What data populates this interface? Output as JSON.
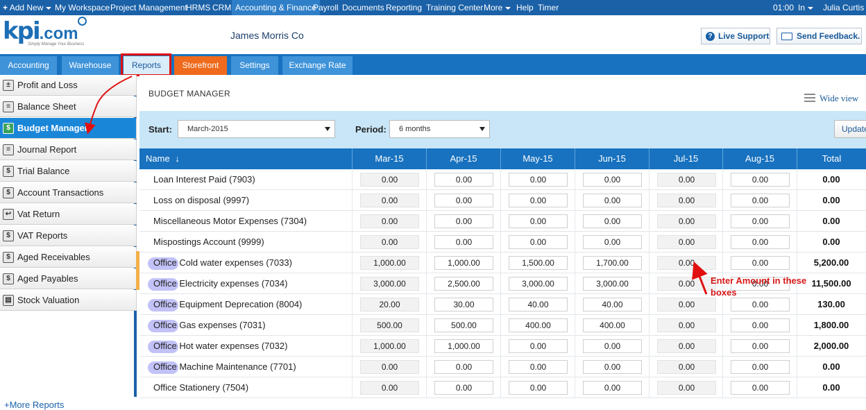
{
  "topnav": {
    "items": [
      {
        "label": "Add New",
        "active": false
      },
      {
        "label": "My Workspace",
        "active": false
      },
      {
        "label": "Project Management",
        "active": false
      },
      {
        "label": "HRMS",
        "active": false
      },
      {
        "label": "CRM",
        "active": false
      },
      {
        "label": "Accounting & Finance",
        "active": true
      },
      {
        "label": "Payroll",
        "active": false
      },
      {
        "label": "Documents",
        "active": false
      },
      {
        "label": "Reporting",
        "active": false
      },
      {
        "label": "Training Center",
        "active": false
      },
      {
        "label": "More",
        "active": false
      },
      {
        "label": "Help",
        "active": false
      },
      {
        "label": "Timer",
        "active": false
      }
    ],
    "clock": "01:00",
    "status": "In",
    "user": "Julia Curtis"
  },
  "header": {
    "logo_main": "kpi",
    "logo_suffix": ".com",
    "logo_tagline": "Simply Manage Your Business",
    "company": "James Morris Co",
    "live_support": "Live Support",
    "send_feedback": "Send Feedback."
  },
  "tabs": [
    {
      "label": "Accounting",
      "state": "normal"
    },
    {
      "label": "Warehouse",
      "state": "normal"
    },
    {
      "label": "Reports",
      "state": "active"
    },
    {
      "label": "Storefront",
      "state": "orange"
    },
    {
      "label": "Settings",
      "state": "normal"
    },
    {
      "label": "Exchange Rate",
      "state": "normal"
    }
  ],
  "sidebar": {
    "items": [
      {
        "label": "Profit and Loss",
        "icon": "profit-loss-icon",
        "active": false
      },
      {
        "label": "Balance Sheet",
        "icon": "balance-sheet-icon",
        "active": false
      },
      {
        "label": "Budget Manager",
        "icon": "budget-manager-icon",
        "active": true
      },
      {
        "label": "Journal Report",
        "icon": "journal-report-icon",
        "active": false
      },
      {
        "label": "Trial Balance",
        "icon": "trial-balance-icon",
        "active": false
      },
      {
        "label": "Account Transactions",
        "icon": "account-transactions-icon",
        "active": false
      },
      {
        "label": "Vat Return",
        "icon": "vat-return-icon",
        "active": false
      },
      {
        "label": "VAT Reports",
        "icon": "vat-reports-icon",
        "active": false
      },
      {
        "label": "Aged Receivables",
        "icon": "aged-receivables-icon",
        "active": false
      },
      {
        "label": "Aged Payables",
        "icon": "aged-payables-icon",
        "active": false
      },
      {
        "label": "Stock Valuation",
        "icon": "stock-valuation-icon",
        "active": false
      }
    ],
    "more": "+More Reports"
  },
  "main": {
    "title": "BUDGET MANAGER",
    "wide_view": "Wide view",
    "start_label": "Start:",
    "start_value": "March-2015",
    "period_label": "Period:",
    "period_value": "6 months",
    "update": "Update"
  },
  "table": {
    "name_header": "Name",
    "months": [
      "Mar-15",
      "Apr-15",
      "May-15",
      "Jun-15",
      "Jul-15",
      "Aug-15"
    ],
    "total_header": "Total",
    "rows": [
      {
        "name": "Loan Interest Paid (7903)",
        "values": [
          "0.00",
          "0.00",
          "0.00",
          "0.00",
          "0.00",
          "0.00"
        ],
        "total": "0.00",
        "highlight": false
      },
      {
        "name": "Loss on disposal (9997)",
        "values": [
          "0.00",
          "0.00",
          "0.00",
          "0.00",
          "0.00",
          "0.00"
        ],
        "total": "0.00",
        "highlight": false
      },
      {
        "name": "Miscellaneous Motor Expenses (7304)",
        "values": [
          "0.00",
          "0.00",
          "0.00",
          "0.00",
          "0.00",
          "0.00"
        ],
        "total": "0.00",
        "highlight": false
      },
      {
        "name": "Mispostings Account (9999)",
        "values": [
          "0.00",
          "0.00",
          "0.00",
          "0.00",
          "0.00",
          "0.00"
        ],
        "total": "0.00",
        "highlight": false
      },
      {
        "name": "Office Cold water expenses (7033)",
        "values": [
          "1,000.00",
          "1,000.00",
          "1,500.00",
          "1,700.00",
          "0.00",
          "0.00"
        ],
        "total": "5,200.00",
        "highlight": true
      },
      {
        "name": "Office Electricity expenses (7034)",
        "values": [
          "3,000.00",
          "2,500.00",
          "3,000.00",
          "3,000.00",
          "0.00",
          "0.00"
        ],
        "total": "11,500.00",
        "highlight": true
      },
      {
        "name": "Office Equipment Deprecation (8004)",
        "values": [
          "20.00",
          "30.00",
          "40.00",
          "40.00",
          "0.00",
          "0.00"
        ],
        "total": "130.00",
        "highlight": true
      },
      {
        "name": "Office Gas expenses (7031)",
        "values": [
          "500.00",
          "500.00",
          "400.00",
          "400.00",
          "0.00",
          "0.00"
        ],
        "total": "1,800.00",
        "highlight": true
      },
      {
        "name": "Office Hot water expenses (7032)",
        "values": [
          "1,000.00",
          "1,000.00",
          "0.00",
          "0.00",
          "0.00",
          "0.00"
        ],
        "total": "2,000.00",
        "highlight": true
      },
      {
        "name": "Office Machine Maintenance (7701)",
        "values": [
          "0.00",
          "0.00",
          "0.00",
          "0.00",
          "0.00",
          "0.00"
        ],
        "total": "0.00",
        "highlight": true
      },
      {
        "name": "Office Stationery (7504)",
        "values": [
          "0.00",
          "0.00",
          "0.00",
          "0.00",
          "0.00",
          "0.00"
        ],
        "total": "0.00",
        "highlight": false
      }
    ]
  },
  "annotation": {
    "text": "Enter Amount in these boxes",
    "color": "#d81818"
  },
  "colors": {
    "nav_blue": "#1a61a8",
    "tab_blue": "#1872bf",
    "active_blue": "#1a86d8",
    "storefront_orange": "#ef6a1c",
    "filter_bg": "#c8e6f8"
  }
}
